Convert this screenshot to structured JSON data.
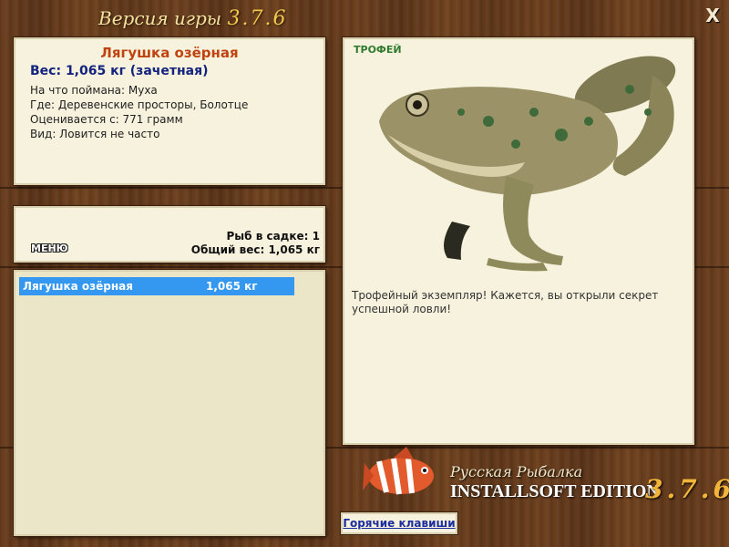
{
  "window": {
    "title_prefix": "Версия игры",
    "title_version": "3.7.6",
    "close_label": "X"
  },
  "info": {
    "fish_name": "Лягушка озёрная",
    "weight": "Вес: 1,065 кг (зачетная)",
    "bait": "На что поймана: Муха",
    "location": "Где: Деревенские просторы, Болотце",
    "rated_from": "Оценивается с: 771 грамм",
    "rarity": "Вид: Ловится не часто"
  },
  "cage": {
    "menu_label": "МЕНЮ",
    "fish_count": "Рыб в садке: 1",
    "total_weight": "Общий вес: 1,065 кг"
  },
  "catch_list": [
    {
      "name": "Лягушка озёрная",
      "weight": "1,065 кг"
    }
  ],
  "trophy": {
    "label": "ТРОФЕЙ",
    "description": "Трофейный экземпляр! Кажется, вы открыли секрет успешной ловли!"
  },
  "branding": {
    "title": "Русская Рыбалка",
    "edition": "INSTALLSOFT EDITION",
    "version": "3.7.6"
  },
  "hotkeys": {
    "label": "Горячие клавиши"
  }
}
